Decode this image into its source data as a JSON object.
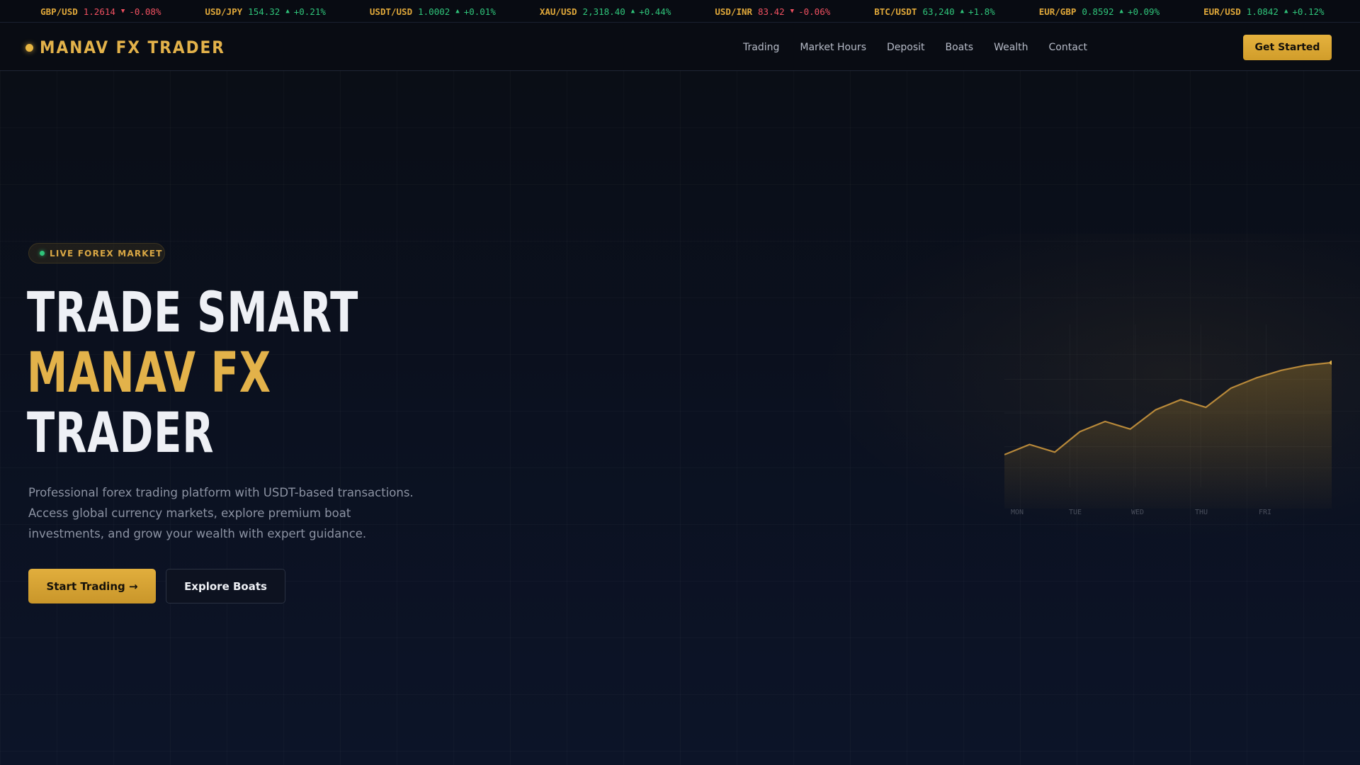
{
  "ticker": [
    {
      "symbol": "",
      "value": "",
      "arrow": "",
      "change": "2%",
      "dir": "up"
    },
    {
      "symbol": "GBP/USD",
      "value": "1.2614",
      "arrow": "▼",
      "change": "-0.08%",
      "dir": "down"
    },
    {
      "symbol": "USD/JPY",
      "value": "154.32",
      "arrow": "▲",
      "change": "+0.21%",
      "dir": "up"
    },
    {
      "symbol": "USDT/USD",
      "value": "1.0002",
      "arrow": "▲",
      "change": "+0.01%",
      "dir": "up"
    },
    {
      "symbol": "XAU/USD",
      "value": "2,318.40",
      "arrow": "▲",
      "change": "+0.44%",
      "dir": "up"
    },
    {
      "symbol": "USD/INR",
      "value": "83.42",
      "arrow": "▼",
      "change": "-0.06%",
      "dir": "down"
    },
    {
      "symbol": "BTC/USDT",
      "value": "63,240",
      "arrow": "▲",
      "change": "+1.8%",
      "dir": "up"
    },
    {
      "symbol": "EUR/GBP",
      "value": "0.8592",
      "arrow": "▲",
      "change": "+0.09%",
      "dir": "up"
    },
    {
      "symbol": "EUR/USD",
      "value": "1.0842",
      "arrow": "▲",
      "change": "+0.12%",
      "dir": "up"
    },
    {
      "symbol": "GBP",
      "value": "",
      "arrow": "",
      "change": "",
      "dir": "up"
    }
  ],
  "nav": {
    "logo": "MANAV FX TRADER",
    "links": [
      "Trading",
      "Market Hours",
      "Deposit",
      "Boats",
      "Wealth",
      "Contact"
    ],
    "cta": "Get Started"
  },
  "hero": {
    "badge": "LIVE FOREX MARKET",
    "line1": "TRADE SMART",
    "line2": "MANAV FX",
    "line3": "TRADER",
    "subtext": "Professional forex trading platform with USDT-based transactions. Access global currency markets, explore premium boat investments, and grow your wealth with expert guidance.",
    "primary_button": "Start Trading →",
    "secondary_button": "Explore Boats"
  },
  "colors": {
    "accent": "#e3b24a",
    "up": "#2fc47a",
    "down": "#ef5060",
    "background": "#0a0e16"
  },
  "chart_data": {
    "type": "area",
    "categories": [
      "MON",
      "TUE",
      "WED",
      "THU",
      "FRI"
    ],
    "x": [
      0,
      1,
      2,
      3,
      4,
      5,
      6,
      7,
      8,
      9,
      10,
      11,
      12,
      13,
      14,
      15,
      16,
      17
    ],
    "values": [
      20,
      28,
      22,
      38,
      46,
      40,
      55,
      63,
      57,
      72,
      80,
      86,
      90,
      92,
      85,
      82,
      84,
      86
    ],
    "series": [
      {
        "values": [
          20,
          28,
          22,
          38,
          46,
          40,
          55,
          63,
          57,
          72,
          80,
          86,
          90,
          92
        ]
      }
    ],
    "title": "",
    "xlabel": "",
    "ylabel": "",
    "grid": true,
    "legend": "none"
  }
}
